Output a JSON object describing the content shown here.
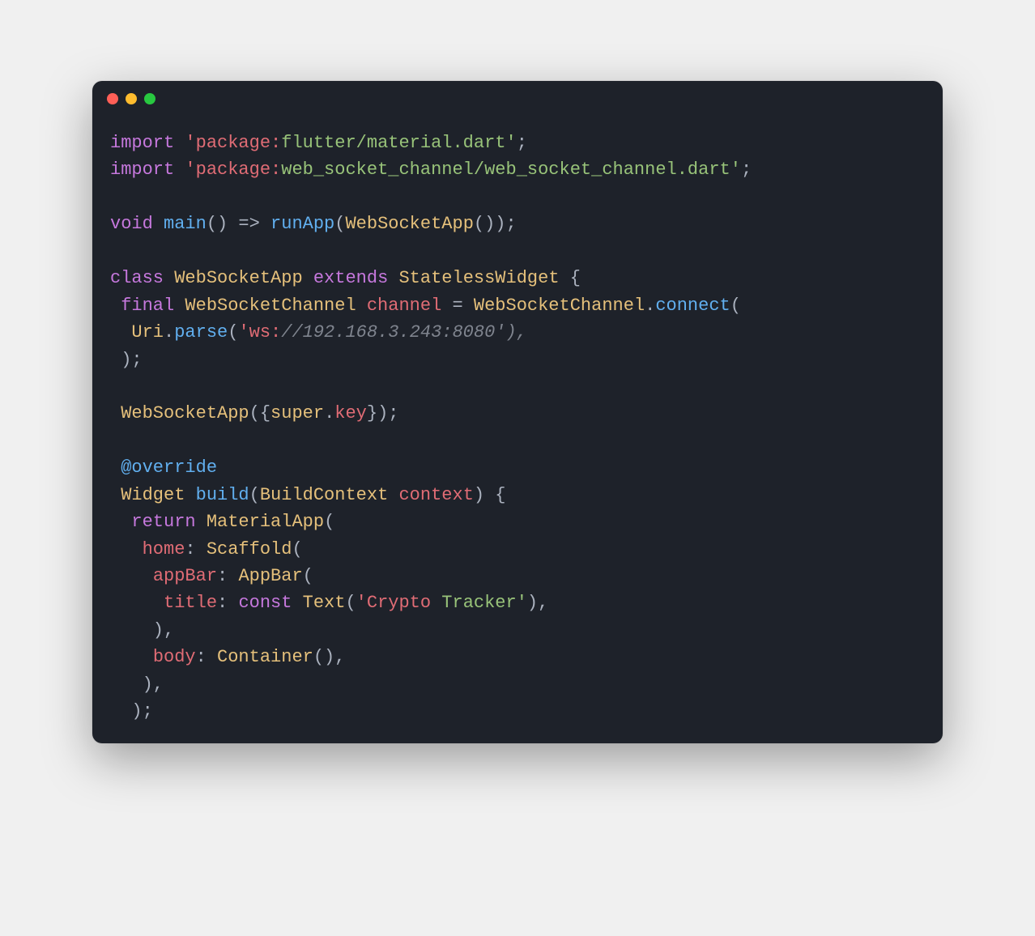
{
  "window": {
    "traffic_lights": [
      "close",
      "minimize",
      "maximize"
    ]
  },
  "code": {
    "lines": [
      [
        {
          "t": "import ",
          "c": "c-keyword"
        },
        {
          "t": "'package:",
          "c": "c-str-red"
        },
        {
          "t": "flutter/material.dart'",
          "c": "c-str"
        },
        {
          "t": ";",
          "c": "c-punct"
        }
      ],
      [
        {
          "t": "import ",
          "c": "c-keyword"
        },
        {
          "t": "'package:",
          "c": "c-str-red"
        },
        {
          "t": "web_socket_channel/web_socket_channel.dart'",
          "c": "c-str"
        },
        {
          "t": ";",
          "c": "c-punct"
        }
      ],
      [],
      [
        {
          "t": "void ",
          "c": "c-keyword"
        },
        {
          "t": "main",
          "c": "c-func"
        },
        {
          "t": "() => ",
          "c": "c-punct"
        },
        {
          "t": "runApp",
          "c": "c-func"
        },
        {
          "t": "(",
          "c": "c-punct"
        },
        {
          "t": "WebSocketApp",
          "c": "c-type"
        },
        {
          "t": "());",
          "c": "c-punct"
        }
      ],
      [],
      [
        {
          "t": "class ",
          "c": "c-keyword"
        },
        {
          "t": "WebSocketApp ",
          "c": "c-type"
        },
        {
          "t": "extends ",
          "c": "c-keyword"
        },
        {
          "t": "StatelessWidget ",
          "c": "c-type"
        },
        {
          "t": "{",
          "c": "c-punct"
        }
      ],
      [
        {
          "t": " ",
          "c": ""
        },
        {
          "t": "final ",
          "c": "c-keyword"
        },
        {
          "t": "WebSocketChannel ",
          "c": "c-type"
        },
        {
          "t": "channel ",
          "c": "c-var"
        },
        {
          "t": "= ",
          "c": "c-punct"
        },
        {
          "t": "WebSocketChannel",
          "c": "c-type"
        },
        {
          "t": ".",
          "c": "c-punct"
        },
        {
          "t": "connect",
          "c": "c-func"
        },
        {
          "t": "(",
          "c": "c-punct"
        }
      ],
      [
        {
          "t": "  ",
          "c": ""
        },
        {
          "t": "Uri",
          "c": "c-type"
        },
        {
          "t": ".",
          "c": "c-punct"
        },
        {
          "t": "parse",
          "c": "c-func"
        },
        {
          "t": "(",
          "c": "c-punct"
        },
        {
          "t": "'ws:",
          "c": "c-str-red"
        },
        {
          "t": "//192.168.3.243:8080'),",
          "c": "c-comment"
        }
      ],
      [
        {
          "t": " );",
          "c": "c-punct"
        }
      ],
      [],
      [
        {
          "t": " ",
          "c": ""
        },
        {
          "t": "WebSocketApp",
          "c": "c-type"
        },
        {
          "t": "({",
          "c": "c-punct"
        },
        {
          "t": "super",
          "c": "c-keyword2"
        },
        {
          "t": ".",
          "c": "c-punct"
        },
        {
          "t": "key",
          "c": "c-var"
        },
        {
          "t": "});",
          "c": "c-punct"
        }
      ],
      [],
      [
        {
          "t": " ",
          "c": ""
        },
        {
          "t": "@override",
          "c": "c-at"
        }
      ],
      [
        {
          "t": " ",
          "c": ""
        },
        {
          "t": "Widget ",
          "c": "c-type"
        },
        {
          "t": "build",
          "c": "c-func"
        },
        {
          "t": "(",
          "c": "c-punct"
        },
        {
          "t": "BuildContext ",
          "c": "c-type"
        },
        {
          "t": "context",
          "c": "c-var"
        },
        {
          "t": ") {",
          "c": "c-punct"
        }
      ],
      [
        {
          "t": "  ",
          "c": ""
        },
        {
          "t": "return ",
          "c": "c-keyword"
        },
        {
          "t": "MaterialApp",
          "c": "c-type"
        },
        {
          "t": "(",
          "c": "c-punct"
        }
      ],
      [
        {
          "t": "   ",
          "c": ""
        },
        {
          "t": "home",
          "c": "c-prop"
        },
        {
          "t": ": ",
          "c": "c-punct"
        },
        {
          "t": "Scaffold",
          "c": "c-type"
        },
        {
          "t": "(",
          "c": "c-punct"
        }
      ],
      [
        {
          "t": "    ",
          "c": ""
        },
        {
          "t": "appBar",
          "c": "c-prop"
        },
        {
          "t": ": ",
          "c": "c-punct"
        },
        {
          "t": "AppBar",
          "c": "c-type"
        },
        {
          "t": "(",
          "c": "c-punct"
        }
      ],
      [
        {
          "t": "     ",
          "c": ""
        },
        {
          "t": "title",
          "c": "c-prop"
        },
        {
          "t": ": ",
          "c": "c-punct"
        },
        {
          "t": "const ",
          "c": "c-const"
        },
        {
          "t": "Text",
          "c": "c-type"
        },
        {
          "t": "(",
          "c": "c-punct"
        },
        {
          "t": "'Crypto",
          "c": "c-str-red"
        },
        {
          "t": " Tracker'",
          "c": "c-str"
        },
        {
          "t": "),",
          "c": "c-punct"
        }
      ],
      [
        {
          "t": "    ),",
          "c": "c-punct"
        }
      ],
      [
        {
          "t": "    ",
          "c": ""
        },
        {
          "t": "body",
          "c": "c-prop"
        },
        {
          "t": ": ",
          "c": "c-punct"
        },
        {
          "t": "Container",
          "c": "c-type"
        },
        {
          "t": "(),",
          "c": "c-punct"
        }
      ],
      [
        {
          "t": "   ),",
          "c": "c-punct"
        }
      ],
      [
        {
          "t": "  );",
          "c": "c-punct"
        }
      ]
    ]
  }
}
